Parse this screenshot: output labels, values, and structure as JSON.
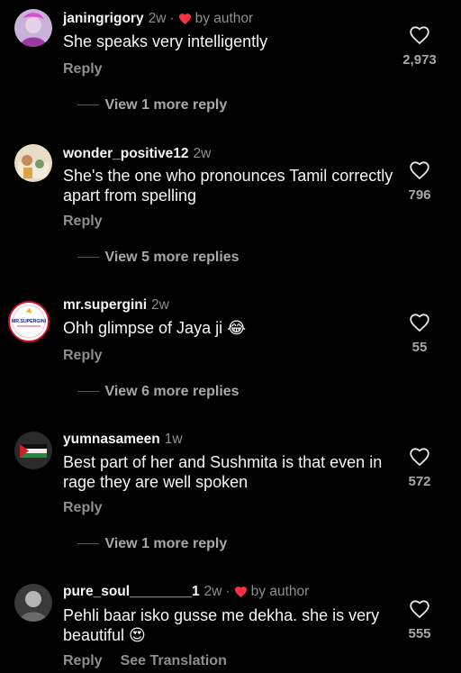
{
  "comments": [
    {
      "username": "janingrigory",
      "time": "2w",
      "by_author": "by author",
      "text": "She speaks very intelligently",
      "reply": "Reply",
      "likes": "2,973",
      "view_more": "View 1 more reply"
    },
    {
      "username": "wonder_positive12",
      "time": "2w",
      "text": "She's the one who pronounces Tamil correctly apart from spelling",
      "reply": "Reply",
      "likes": "796",
      "view_more": "View 5 more replies"
    },
    {
      "username": "mr.supergini",
      "time": "2w",
      "text": "Ohh glimpse of Jaya ji 😂",
      "reply": "Reply",
      "likes": "55",
      "view_more": "View 6 more replies",
      "avatar_text": "MR.SUPERGINI"
    },
    {
      "username": "yumnasameen",
      "time": "1w",
      "text": "Best part of her and Sushmita is that even in rage they are well spoken",
      "reply": "Reply",
      "likes": "572",
      "view_more": "View 1 more reply"
    },
    {
      "username": "pure_soul________1",
      "time": "2w",
      "by_author": "by author",
      "text": "Pehli baar isko gusse me dekha. she is very beautiful 😍",
      "reply": "Reply",
      "see_translation": "See Translation",
      "likes": "555"
    }
  ],
  "colors": {
    "background": "#000000",
    "text": "#f5f5f5",
    "muted": "#8e8e8e",
    "heart_red": "#ff3040"
  }
}
